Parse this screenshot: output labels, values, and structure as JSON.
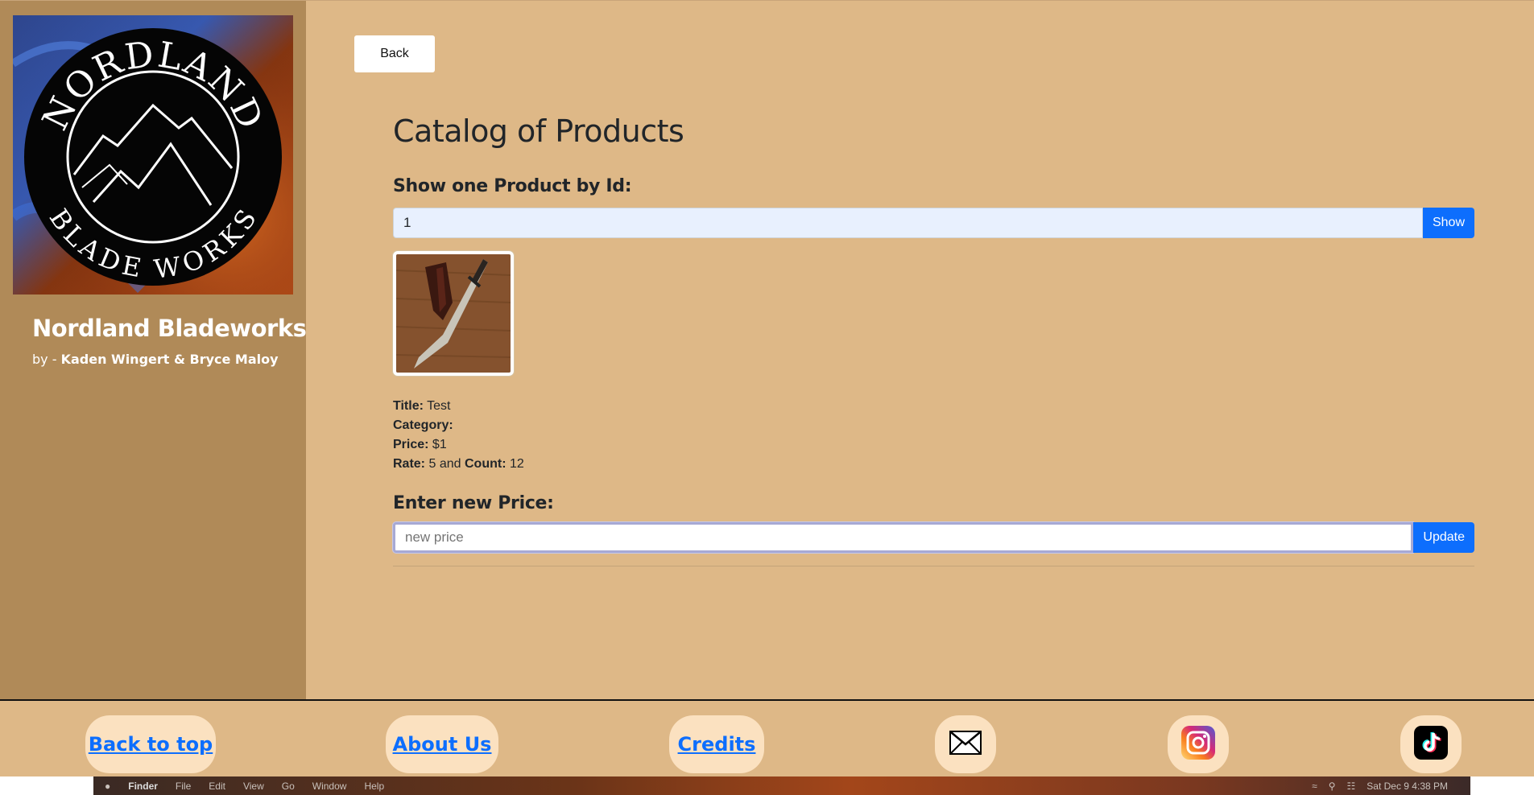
{
  "sidebar": {
    "brand_title": "Nordland Bladeworks",
    "by_prefix": "by - ",
    "authors": "Kaden Wingert & Bryce Maloy",
    "logo": {
      "top_text": "NORDLAND",
      "bottom_text": "BLADE WORKS"
    }
  },
  "main": {
    "back_label": "Back",
    "page_title": "Catalog of Products",
    "show_section": {
      "heading": "Show one Product by Id:",
      "input_value": "1",
      "button_label": "Show"
    },
    "product": {
      "title_label": "Title:",
      "title_value": "Test",
      "category_label": "Category:",
      "category_value": "",
      "price_label": "Price:",
      "price_value": "$1",
      "rate_label": "Rate:",
      "rate_value": "5",
      "and_text": "and",
      "count_label": "Count:",
      "count_value": "12"
    },
    "price_section": {
      "heading": "Enter new Price:",
      "placeholder": "new price",
      "button_label": "Update"
    }
  },
  "footer": {
    "back_to_top": "Back to top",
    "about_us": "About Us",
    "credits": "Credits",
    "icons": [
      "mail-icon",
      "instagram-icon",
      "tiktok-icon"
    ]
  },
  "menubar": {
    "items": [
      "Finder",
      "File",
      "Edit",
      "View",
      "Go",
      "Window",
      "Help"
    ],
    "datetime": "Sat Dec 9  4:38 PM"
  },
  "colors": {
    "sidebar_bg": "#b08a58",
    "main_bg": "#deb887",
    "accent": "#0d6efd",
    "pill_bg": "#fbe1c0"
  }
}
